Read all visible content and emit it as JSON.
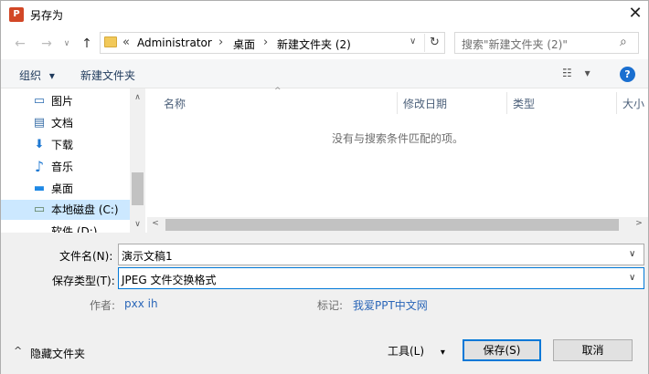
{
  "window": {
    "title": "另存为",
    "logo_letter": "P"
  },
  "nav": {
    "back": "←",
    "forward": "→",
    "dropdown": "∨",
    "up": "↑"
  },
  "address": {
    "overflow": "«",
    "crumbs": [
      "Administrator",
      "桌面",
      "新建文件夹 (2)"
    ],
    "separator": "›",
    "chevron": "∨",
    "refresh": "↻"
  },
  "search": {
    "placeholder": "搜索\"新建文件夹 (2)\"",
    "icon": "⌕"
  },
  "toolbar": {
    "organize": "组织",
    "organize_caret": "▾",
    "new_folder": "新建文件夹",
    "view_icon": "☷",
    "view_caret": "▾",
    "help": "?"
  },
  "sidebar": {
    "items": [
      {
        "label": "图片",
        "icon": "picture-icon",
        "glyph": "▭"
      },
      {
        "label": "文档",
        "icon": "document-icon",
        "glyph": "▤"
      },
      {
        "label": "下载",
        "icon": "download-icon",
        "glyph": "⬇"
      },
      {
        "label": "音乐",
        "icon": "music-icon",
        "glyph": "♪"
      },
      {
        "label": "桌面",
        "icon": "desktop-icon",
        "glyph": "▬"
      },
      {
        "label": "本地磁盘 (C:)",
        "icon": "drive-icon",
        "glyph": "▭"
      },
      {
        "label": "软件 (D:)",
        "icon": "drive-icon",
        "glyph": "▭"
      }
    ],
    "selected_index": 5,
    "scroll_up": "∧",
    "scroll_down": "∨"
  },
  "filelist": {
    "columns": [
      "名称",
      "修改日期",
      "类型",
      "大小"
    ],
    "sort_indicator": "^",
    "empty_message": "没有与搜索条件匹配的项。",
    "scroll_left": "<",
    "scroll_right": ">"
  },
  "form": {
    "filename_label": "文件名(N):",
    "filename_value": "演示文稿1",
    "filetype_label": "保存类型(T):",
    "filetype_value": "JPEG 文件交换格式",
    "author_label": "作者:",
    "author_value": "pxx ih",
    "tags_label": "标记:",
    "tags_value": "我爱PPT中文网",
    "chevron": "∨"
  },
  "footer": {
    "hide_folders": "隐藏文件夹",
    "hide_caret": "^",
    "tools": "工具(L)",
    "tools_caret": "▾",
    "save": "保存(S)",
    "cancel": "取消"
  },
  "colors": {
    "accent": "#0078d7",
    "selection": "#cce8ff",
    "link": "#2a66b8",
    "help": "#1a6fd0"
  }
}
